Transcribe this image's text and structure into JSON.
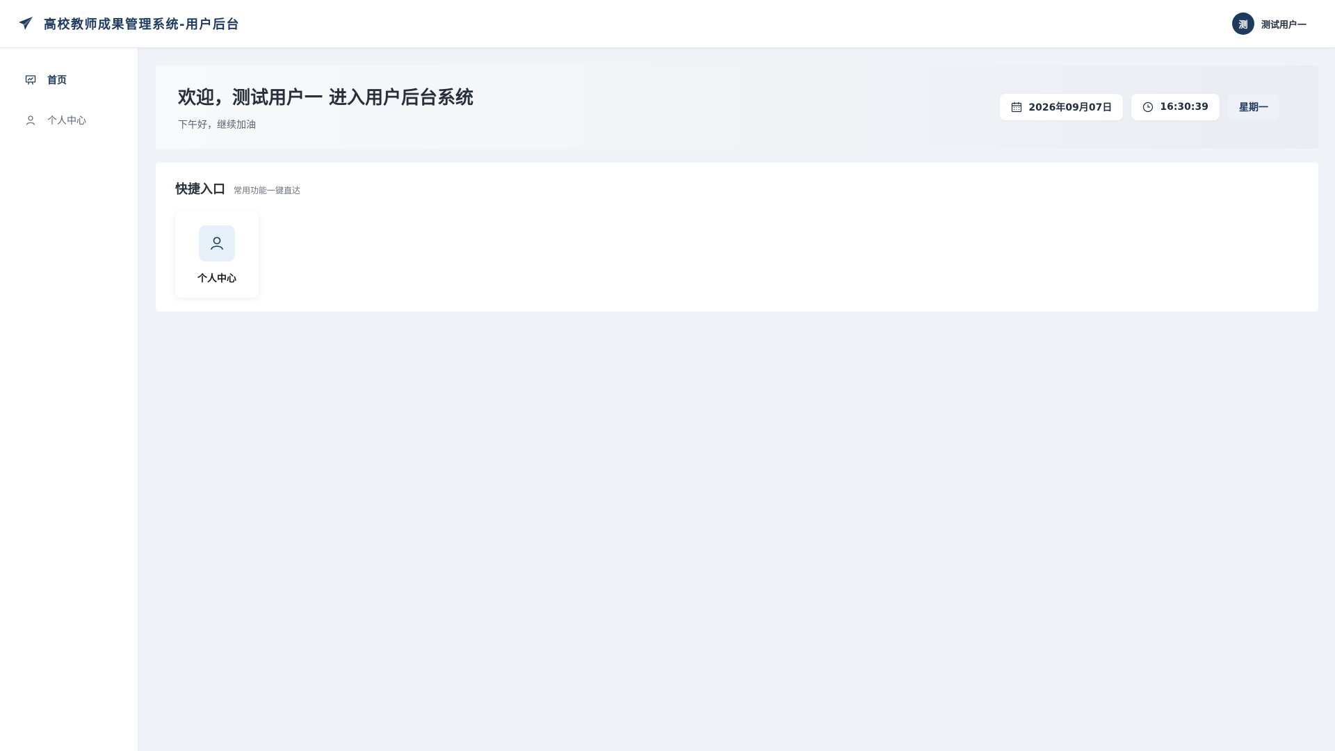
{
  "header": {
    "title": "高校教师成果管理系统-用户后台",
    "logo_icon": "paper-plane-icon",
    "user": {
      "avatar_text": "测",
      "name": "测试用户一"
    }
  },
  "sidebar": {
    "items": [
      {
        "label": "首页",
        "icon": "presentation-chart-icon",
        "active": true
      },
      {
        "label": "个人中心",
        "icon": "user-icon",
        "active": false
      }
    ]
  },
  "welcome": {
    "title": "欢迎，测试用户一 进入用户后台系统",
    "subtitle": "下午好，继续加油",
    "date": "2026年09月07日",
    "time": "16:30:39",
    "weekday": "星期一"
  },
  "quick": {
    "title": "快捷入口",
    "subtitle": "常用功能一键直达",
    "items": [
      {
        "label": "个人中心",
        "icon": "user-icon"
      }
    ]
  },
  "colors": {
    "brand": "#1f3a5f",
    "background": "#f0f3f7",
    "quick_icon_bg": "#e6f1fb"
  }
}
